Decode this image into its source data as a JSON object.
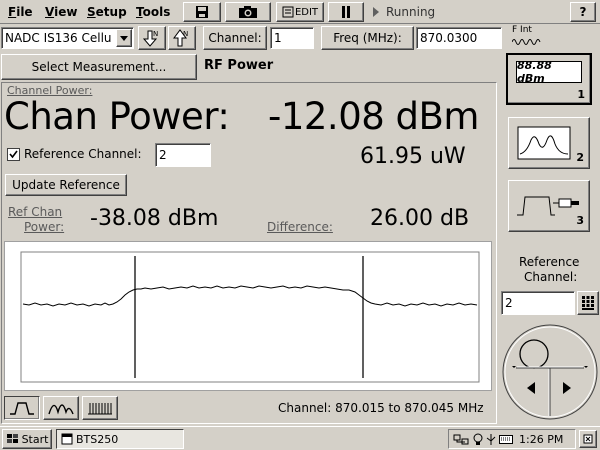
{
  "menu": {
    "items": [
      "File",
      "View",
      "Setup",
      "Tools"
    ],
    "edit_label": "EDIT",
    "status": "Running",
    "help": "?"
  },
  "toolbar": {
    "standard": "NADC IS136 Cellu",
    "channel_label": "Channel:",
    "channel_value": "1",
    "freq_label": "Freq (MHz):",
    "freq_value": "870.0300",
    "fint_label": "F Int"
  },
  "measurement": {
    "select_button": "Select Measurement...",
    "title": "RF Power"
  },
  "readout": {
    "channel_power_small": "Channel Power:",
    "chan_power_label": "Chan Power:",
    "chan_power_value": "-12.08 dBm",
    "ref_checkbox_label": "Reference Channel:",
    "ref_channel_value": "2",
    "uw_value": "61.95 uW",
    "update_button": "Update Reference",
    "ref_chan_power_label_1": "Ref Chan",
    "ref_chan_power_label_2": "Power:",
    "ref_chan_power_value": "-38.08 dBm",
    "difference_label": "Difference:",
    "difference_value": "26.00 dB"
  },
  "graph": {
    "channel_range": "Channel: 870.015 to 870.045 MHz"
  },
  "side_panel": {
    "view1_display": "88.88 dBm",
    "view1_num": "1",
    "view2_num": "2",
    "view3_num": "3",
    "ref_label_1": "Reference",
    "ref_label_2": "Channel:",
    "ref_value": "2"
  },
  "taskbar": {
    "start": "Start",
    "task": "BTS250",
    "time": "1:26 PM"
  }
}
